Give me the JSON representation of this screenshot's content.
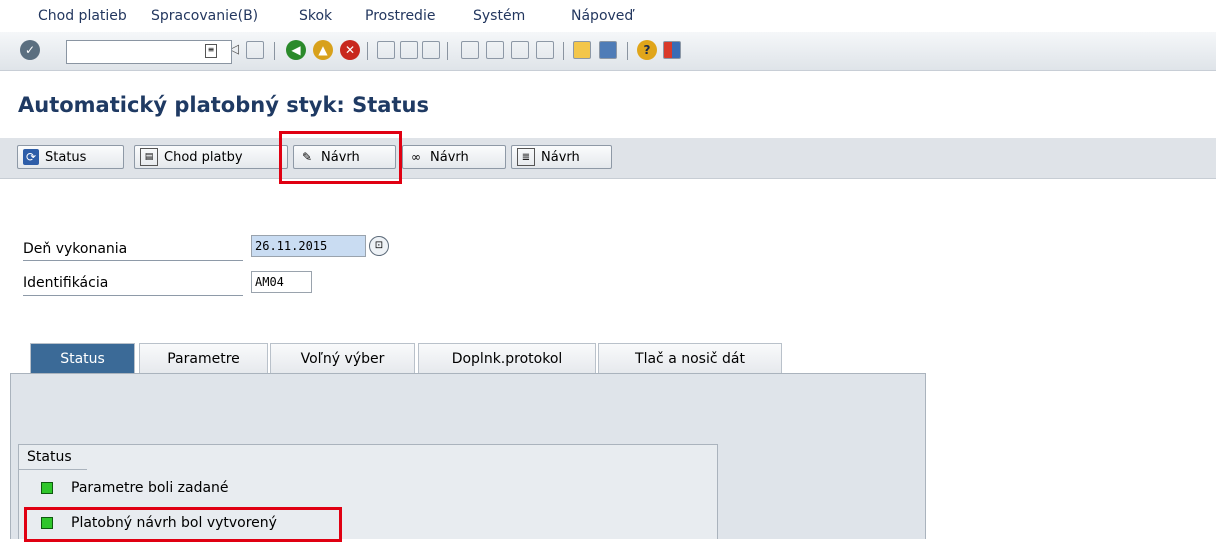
{
  "menu": {
    "items": [
      {
        "label": "Chod platieb"
      },
      {
        "label": "Spracovanie(B)"
      },
      {
        "label": "Skok"
      },
      {
        "label": "Prostredie"
      },
      {
        "label": "Systém"
      },
      {
        "label": "Nápoveď"
      }
    ]
  },
  "system_toolbar": {
    "icons": [
      "enter-icon",
      "command-field-dropdown-icon",
      "back-arrow-icon",
      "save-icon",
      "back-icon",
      "exit-icon",
      "cancel-icon",
      "print-icon",
      "find-icon",
      "find-next-icon",
      "first-page-icon",
      "previous-page-icon",
      "next-page-icon",
      "last-page-icon",
      "new-session-icon",
      "shortcut-icon",
      "help-icon",
      "customize-layout-icon"
    ],
    "command_value": ""
  },
  "page": {
    "title": "Automatický platobný styk: Status"
  },
  "app_toolbar": {
    "buttons": [
      {
        "label": "Status",
        "icon": "refresh-icon"
      },
      {
        "label": "Chod platby",
        "icon": "schedule-icon"
      },
      {
        "label": "Návrh",
        "icon": "pencil-icon"
      },
      {
        "label": "Návrh",
        "icon": "glasses-icon"
      },
      {
        "label": "Návrh",
        "icon": "list-icon"
      }
    ]
  },
  "fields": {
    "run_date": {
      "label": "Deň vykonania",
      "value": "26.11.2015"
    },
    "identification": {
      "label": "Identifikácia",
      "value": "AM04"
    }
  },
  "tabs": [
    {
      "label": "Status",
      "active": true
    },
    {
      "label": "Parametre",
      "active": false
    },
    {
      "label": "Voľný výber",
      "active": false
    },
    {
      "label": "Doplnk.protokol",
      "active": false
    },
    {
      "label": "Tlač a nosič dát",
      "active": false
    }
  ],
  "status_group": {
    "title": "Status",
    "items": [
      {
        "label": "Parametre boli zadané",
        "status": "green"
      },
      {
        "label": "Platobný návrh bol vytvorený",
        "status": "green"
      }
    ]
  },
  "colors": {
    "title": "#1f3a63",
    "active_tab": "#3b6a97",
    "highlight": "#e00012",
    "led_green": "#2fc62b"
  }
}
